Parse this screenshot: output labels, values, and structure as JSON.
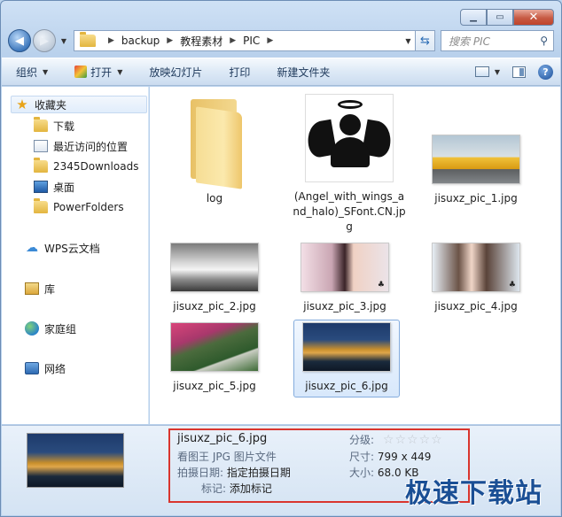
{
  "window": {
    "caption_buttons": [
      "minimize",
      "maximize",
      "close"
    ]
  },
  "nav": {
    "breadcrumb": [
      "backup",
      "教程素材",
      "PIC"
    ],
    "search_placeholder": "搜索 PIC"
  },
  "toolbar": {
    "organize": "组织",
    "open": "打开",
    "slideshow": "放映幻灯片",
    "print": "打印",
    "new_folder": "新建文件夹"
  },
  "sidebar": {
    "favorites": "收藏夹",
    "items": [
      {
        "label": "下载",
        "icon": "folder-icon"
      },
      {
        "label": "最近访问的位置",
        "icon": "recent-places-icon"
      },
      {
        "label": "2345Downloads",
        "icon": "folder-icon"
      },
      {
        "label": "桌面",
        "icon": "desktop-icon"
      },
      {
        "label": "PowerFolders",
        "icon": "folder-icon"
      }
    ],
    "wps": "WPS云文档",
    "library": "库",
    "homegroup": "家庭组",
    "network": "网络"
  },
  "files": [
    {
      "name": "log",
      "type": "folder"
    },
    {
      "name": "(Angel_with_wings_and_halo)_SFont.CN.jpg",
      "type": "image"
    },
    {
      "name": "jisuxz_pic_1.jpg",
      "type": "image"
    },
    {
      "name": "jisuxz_pic_2.jpg",
      "type": "image"
    },
    {
      "name": "jisuxz_pic_3.jpg",
      "type": "image"
    },
    {
      "name": "jisuxz_pic_4.jpg",
      "type": "image"
    },
    {
      "name": "jisuxz_pic_5.jpg",
      "type": "image"
    },
    {
      "name": "jisuxz_pic_6.jpg",
      "type": "image",
      "selected": true
    }
  ],
  "details": {
    "filename": "jisuxz_pic_6.jpg",
    "filetype": "看图王 JPG 图片文件",
    "date_key": "拍摄日期:",
    "date_val": "指定拍摄日期",
    "tags_key": "标记:",
    "tags_val": "添加标记",
    "rating_key": "分级:",
    "rating_stars": 0,
    "size_key": "尺寸:",
    "size_val": "799 x 449",
    "filesize_key": "大小:",
    "filesize_val": "68.0 KB"
  },
  "watermark": "极速下载站"
}
